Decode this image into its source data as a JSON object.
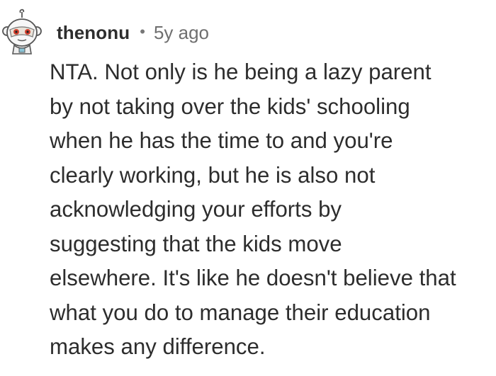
{
  "comment": {
    "author": "thenonu",
    "separator": "•",
    "age": "5y ago",
    "avatar_icon": "snoo-avatar-icon",
    "body_lines": [
      "NTA. Not only is he being a lazy parent",
      "by not taking over the kids' schooling",
      "when he has the time to and you're",
      "clearly working, but he is also not",
      "acknowledging your efforts by",
      "suggesting that the kids move",
      "elsewhere. It's like he doesn't believe that",
      "what you do to manage their education",
      "makes any difference."
    ]
  },
  "colors": {
    "text": "#2d2d2d",
    "meta": "#6f6f6f",
    "background": "#ffffff"
  }
}
